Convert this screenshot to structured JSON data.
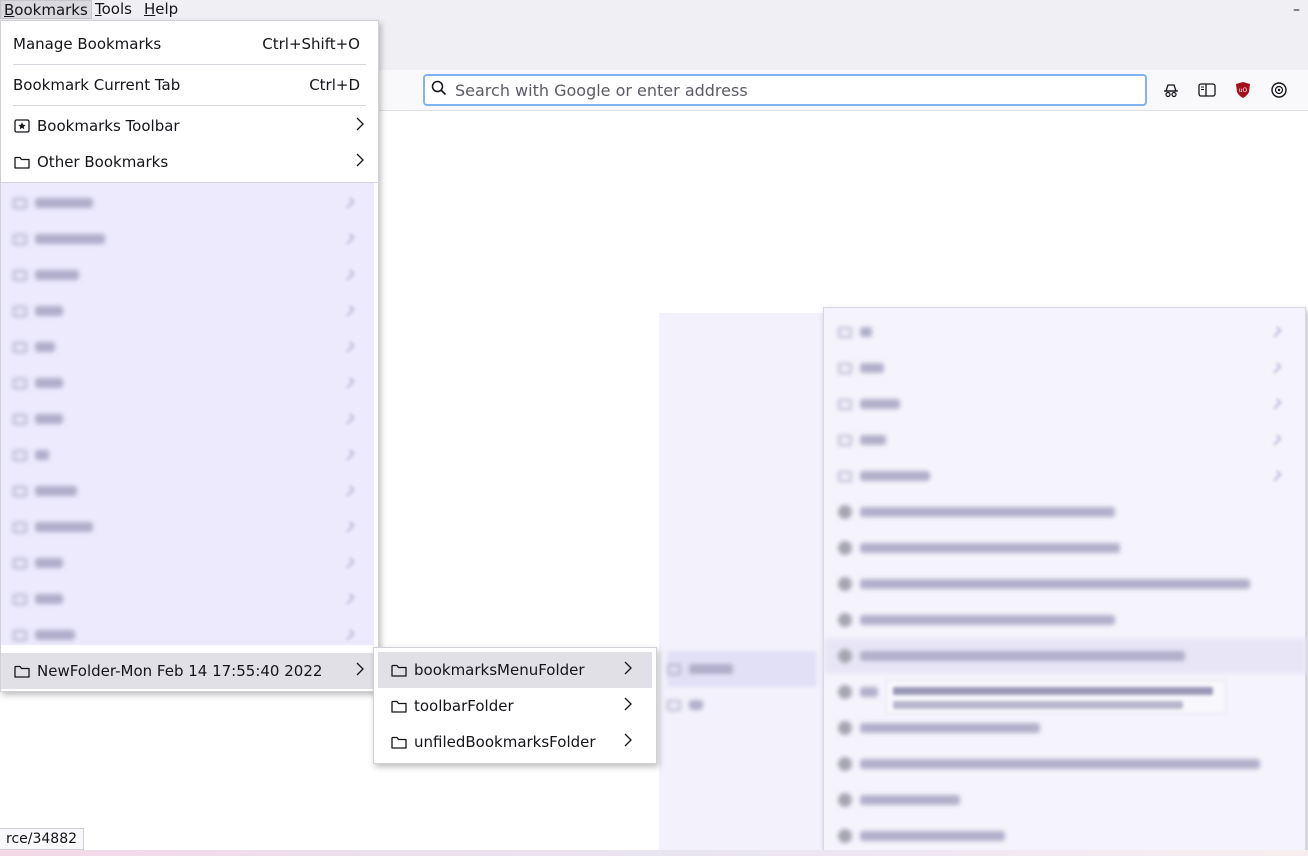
{
  "menubar": {
    "items": [
      {
        "label": "Bookmarks",
        "active": true
      },
      {
        "label": "Tools",
        "active": false
      },
      {
        "label": "Help",
        "active": false
      }
    ],
    "minimize_glyph": "–"
  },
  "urlbar": {
    "placeholder": "Search with Google or enter address",
    "icon": "search-icon"
  },
  "toolbar_icons": [
    "incognito-icon",
    "sidebar-icon",
    "ublock-shield-icon",
    "extensions-icon"
  ],
  "colors": {
    "accent_focus": "#80b4f0",
    "ublock_red": "#a4101c",
    "blurred_highlight": "#eceafc"
  },
  "bookmarks_menu": {
    "manage": {
      "label": "Manage Bookmarks",
      "shortcut": "Ctrl+Shift+O"
    },
    "current_tab": {
      "label": "Bookmark Current Tab",
      "shortcut": "Ctrl+D"
    },
    "toolbar": {
      "label": "Bookmarks Toolbar"
    },
    "other": {
      "label": "Other Bookmarks"
    },
    "new_folder": {
      "label": "NewFolder-Mon Feb 14 17:55:40 2022"
    }
  },
  "submenu_1": {
    "items": [
      {
        "label": "bookmarksMenuFolder"
      },
      {
        "label": "toolbarFolder"
      },
      {
        "label": "unfiledBookmarksFolder"
      }
    ]
  },
  "status_bar": {
    "text": "rce/34882"
  }
}
